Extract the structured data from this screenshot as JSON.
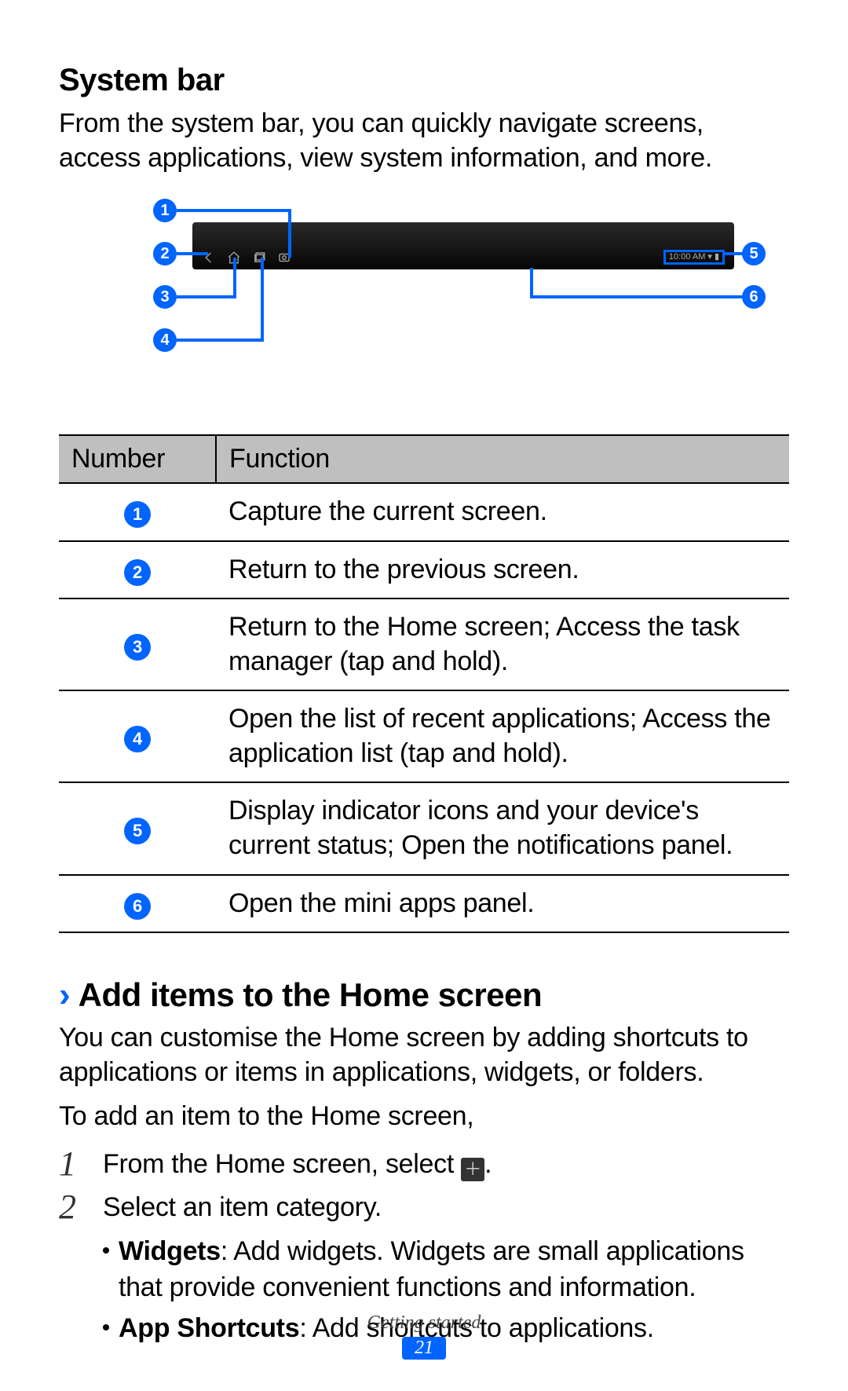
{
  "heading": "System bar",
  "intro": "From the system bar, you can quickly navigate screens, access applications, view system information, and more.",
  "status_text": "10:00 AM",
  "table": {
    "headers": {
      "num": "Number",
      "func": "Function"
    },
    "rows": [
      {
        "n": "1",
        "f": "Capture the current screen."
      },
      {
        "n": "2",
        "f": "Return to the previous screen."
      },
      {
        "n": "3",
        "f": "Return to the Home screen; Access the task manager (tap and hold)."
      },
      {
        "n": "4",
        "f": "Open the list of recent applications; Access the application list (tap and hold)."
      },
      {
        "n": "5",
        "f": "Display indicator icons and your device's current status; Open the notifications panel."
      },
      {
        "n": "6",
        "f": "Open the mini apps panel."
      }
    ]
  },
  "sub_heading": "Add items to the Home screen",
  "sub_intro": "You can customise the Home screen by adding shortcuts to applications or items in applications, widgets, or folders.",
  "sub_intro2": "To add an item to the Home screen,",
  "steps": {
    "s1_pre": "From the Home screen, select ",
    "s1_post": ".",
    "s2": "Select an item category.",
    "bullets": [
      {
        "b": "Widgets",
        "t": ": Add widgets. Widgets are small applications that provide convenient functions and information."
      },
      {
        "b": "App Shortcuts",
        "t": ": Add shortcuts to applications."
      }
    ]
  },
  "footer": {
    "section": "Getting started",
    "page": "21"
  }
}
